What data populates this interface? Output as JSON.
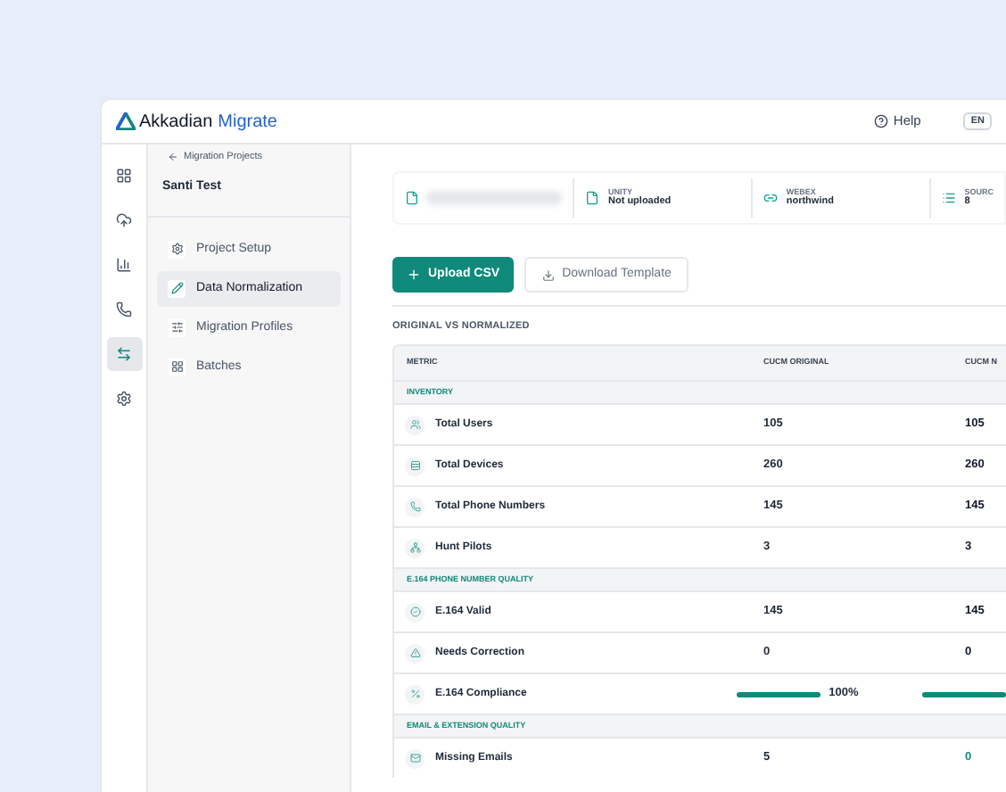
{
  "app": {
    "brand": "Akkadian",
    "product": "Migrate",
    "help": "Help",
    "language": "EN"
  },
  "rail": [
    {
      "selected": false
    },
    {
      "selected": false
    },
    {
      "selected": false
    },
    {
      "selected": false
    },
    {
      "selected": true
    },
    {
      "selected": false
    }
  ],
  "sidebar": {
    "back": "Migration Projects",
    "project": "Santi Test",
    "items": [
      {
        "label": "Project Setup",
        "selected": false
      },
      {
        "label": "Data Normalization",
        "selected": true
      },
      {
        "label": "Migration Profiles",
        "selected": false
      },
      {
        "label": "Batches",
        "selected": false
      }
    ]
  },
  "summary": [
    {
      "kind": "redacted"
    },
    {
      "kind": "file",
      "label": "UNITY",
      "value": "Not uploaded"
    },
    {
      "kind": "link",
      "label": "WEBEX",
      "value": "northwind"
    },
    {
      "kind": "list",
      "label": "SOURC",
      "value": "8"
    }
  ],
  "actions": {
    "upload": "Upload CSV",
    "download": "Download Template"
  },
  "table": {
    "heading": "ORIGINAL VS NORMALIZED",
    "columns": [
      "METRIC",
      "CUCM ORIGINAL",
      "CUCM N"
    ],
    "rows": [
      {
        "kind": "section",
        "label": "INVENTORY"
      },
      {
        "kind": "metric",
        "metric": "Total Users",
        "original": "105",
        "normalized": "105",
        "changed": false
      },
      {
        "kind": "metric",
        "metric": "Total Devices",
        "original": "260",
        "normalized": "260",
        "changed": false
      },
      {
        "kind": "metric",
        "metric": "Total Phone Numbers",
        "original": "145",
        "normalized": "145",
        "changed": false
      },
      {
        "kind": "metric",
        "metric": "Hunt Pilots",
        "original": "3",
        "normalized": "3",
        "changed": false
      },
      {
        "kind": "section",
        "label": "E.164 PHONE NUMBER QUALITY"
      },
      {
        "kind": "metric",
        "metric": "E.164 Valid",
        "original": "145",
        "normalized": "145",
        "changed": false
      },
      {
        "kind": "metric",
        "metric": "Needs Correction",
        "original": "0",
        "normalized": "0",
        "changed": false
      },
      {
        "kind": "progress",
        "metric": "E.164 Compliance",
        "original": {
          "level": 1,
          "reading": "100%"
        },
        "normalized": {
          "level": 1
        }
      },
      {
        "kind": "section",
        "label": "EMAIL & EXTENSION QUALITY"
      },
      {
        "kind": "metric",
        "metric": "Missing Emails",
        "original": "5",
        "normalized": "0",
        "changed": true
      }
    ]
  }
}
